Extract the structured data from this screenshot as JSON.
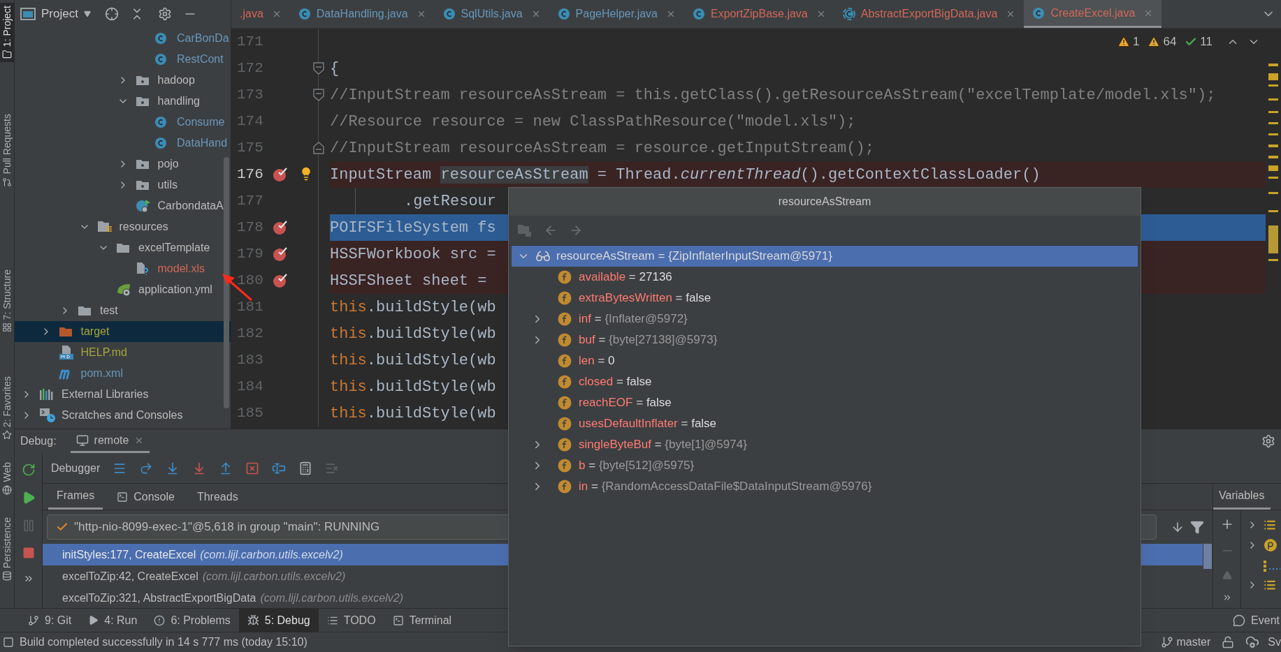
{
  "left_tool_strip": [
    {
      "label": "1: Project",
      "selected": true
    },
    {
      "label": "Pull Requests",
      "selected": false
    },
    {
      "label": "7: Structure",
      "selected": false
    },
    {
      "label": "2: Favorites",
      "selected": false
    },
    {
      "label": "Web",
      "selected": false
    },
    {
      "label": "Persistence",
      "selected": false
    }
  ],
  "project_panel": {
    "title": "Project",
    "tree": [
      {
        "children": [
          {
            "children": [
              {
                "children": [
                  {
                    "children": [
                      {
                        "children": [
                          {
                            "children": [
                              {
                                "label": "CarBonDa",
                                "kind": "class",
                                "color": "#6897bb",
                                "selected": false
                              },
                              {
                                "label": "RestCont",
                                "kind": "class",
                                "color": "#6897bb",
                                "selected": false
                              }
                            ]
                          },
                          {
                            "label": "hadoop",
                            "kind": "package",
                            "color": "#bbbbbb",
                            "expanded": false,
                            "selected": false
                          },
                          {
                            "label": "handling",
                            "kind": "package",
                            "color": "#bbbbbb",
                            "expanded": true,
                            "selected": false,
                            "children": [
                              {
                                "label": "Consume",
                                "kind": "class",
                                "color": "#6897bb",
                                "selected": false
                              },
                              {
                                "label": "DataHand",
                                "kind": "class",
                                "color": "#6897bb",
                                "selected": false
                              }
                            ]
                          },
                          {
                            "label": "pojo",
                            "kind": "package",
                            "color": "#bbbbbb",
                            "expanded": false,
                            "selected": false
                          },
                          {
                            "label": "utils",
                            "kind": "package",
                            "color": "#bbbbbb",
                            "expanded": false,
                            "selected": false
                          },
                          {
                            "label": "CarbondataA",
                            "kind": "boot-class",
                            "color": "#bbbbbb",
                            "selected": false
                          }
                        ]
                      }
                    ]
                  },
                  {
                    "label": "resources",
                    "kind": "resources-folder",
                    "color": "#bbbbbb",
                    "expanded": true,
                    "selected": false,
                    "children": [
                      {
                        "label": "excelTemplate",
                        "kind": "folder",
                        "color": "#bbbbbb",
                        "expanded": true,
                        "selected": false,
                        "children": [
                          {
                            "label": "model.xls",
                            "kind": "unknown-file",
                            "color": "#d1675a",
                            "selected": false
                          }
                        ]
                      },
                      {
                        "label": "application.yml",
                        "kind": "spring-config",
                        "color": "#bbbbbb",
                        "selected": false
                      }
                    ]
                  }
                ]
              },
              {
                "label": "test",
                "kind": "folder",
                "color": "#bbbbbb",
                "expanded": false,
                "selected": false
              }
            ]
          },
          {
            "label": "target",
            "kind": "excluded-folder",
            "color": "#a8a43c",
            "expanded": false,
            "selected": true
          },
          {
            "label": "HELP.md",
            "kind": "markdown",
            "color": "#a8a43c",
            "selected": false
          },
          {
            "label": "pom.xml",
            "kind": "maven",
            "color": "#6897bb",
            "selected": false
          }
        ]
      },
      {
        "label": "External Libraries",
        "kind": "libraries",
        "color": "#bbbbbb",
        "expanded": false,
        "selected": false
      },
      {
        "label": "Scratches and Consoles",
        "kind": "scratches",
        "color": "#bbbbbb",
        "expanded": false,
        "selected": false
      }
    ]
  },
  "editor": {
    "tabs": [
      {
        "label": ".java",
        "kind": "cut",
        "color": "#d1675a",
        "selected": false
      },
      {
        "label": "DataHandling.java",
        "kind": "class",
        "color": "#6897bb",
        "selected": false
      },
      {
        "label": "SqlUtils.java",
        "kind": "class",
        "color": "#6897bb",
        "selected": false
      },
      {
        "label": "PageHelper.java",
        "kind": "class",
        "color": "#6897bb",
        "selected": false
      },
      {
        "label": "ExportZipBase.java",
        "kind": "class",
        "color": "#d1675a",
        "selected": false
      },
      {
        "label": "AbstractExportBigData.java",
        "kind": "abstract",
        "color": "#d1675a",
        "selected": false
      },
      {
        "label": "CreateExcel.java",
        "kind": "class",
        "color": "#d1675a",
        "selected": true
      }
    ],
    "inspections": [
      {
        "kind": "warning",
        "count": "1"
      },
      {
        "kind": "weak-warning",
        "count": "64"
      },
      {
        "kind": "typo",
        "count": "11"
      }
    ],
    "lines": [
      {
        "number": "171",
        "kind": "plain",
        "current": false,
        "breakpoint": false,
        "execution": false,
        "bulb": false
      },
      {
        "number": "172",
        "kind": "fold-start",
        "current": false,
        "breakpoint": false,
        "execution": false,
        "bulb": false,
        "segments": [
          {
            "text": "{",
            "kind": "plain"
          }
        ]
      },
      {
        "number": "173",
        "kind": "fold-start",
        "current": false,
        "breakpoint": false,
        "execution": false,
        "bulb": false,
        "segments": [
          {
            "text": "//InputStream resourceAsStream = this.getClass().getResourceAsStream(\"excelTemplate/model.xls\");",
            "kind": "comment"
          }
        ]
      },
      {
        "number": "174",
        "kind": "plain",
        "current": false,
        "breakpoint": false,
        "execution": false,
        "bulb": false,
        "segments": [
          {
            "text": "//Resource resource = new ClassPathResource(\"model.xls\");",
            "kind": "comment"
          }
        ]
      },
      {
        "number": "175",
        "kind": "fold-end",
        "current": false,
        "breakpoint": false,
        "execution": false,
        "bulb": false,
        "segments": [
          {
            "text": "//InputStream resourceAsStream = resource.getInputStream();",
            "kind": "comment"
          }
        ]
      },
      {
        "number": "176",
        "kind": "plain",
        "current": true,
        "breakpoint": true,
        "execution": false,
        "bulb": true,
        "segments": [
          {
            "text": "InputStream ",
            "kind": "plain"
          },
          {
            "text": "resourceAsStream",
            "kind": "highlight"
          },
          {
            "text": " = Thread.",
            "kind": "plain"
          },
          {
            "text": "currentThread",
            "kind": "italic"
          },
          {
            "text": "().getContextClassLoader()",
            "kind": "plain"
          }
        ]
      },
      {
        "number": "177",
        "kind": "continuation",
        "current": false,
        "breakpoint": false,
        "execution": false,
        "bulb": false,
        "segments": [
          {
            "text": ".getResour",
            "kind": "plain"
          }
        ]
      },
      {
        "number": "178",
        "kind": "plain",
        "current": false,
        "breakpoint": true,
        "execution": true,
        "bulb": false,
        "segments": [
          {
            "text": "POIFSFileSystem fs",
            "kind": "plain"
          }
        ]
      },
      {
        "number": "179",
        "kind": "plain",
        "current": false,
        "breakpoint": true,
        "execution": false,
        "bulb": false,
        "segments": [
          {
            "text": "HSSFWorkbook src =",
            "kind": "plain"
          }
        ]
      },
      {
        "number": "180",
        "kind": "plain",
        "current": false,
        "breakpoint": true,
        "execution": false,
        "bulb": false,
        "segments": [
          {
            "text": "HSSFSheet sheet =",
            "kind": "plain"
          }
        ]
      },
      {
        "number": "181",
        "kind": "plain",
        "current": false,
        "breakpoint": false,
        "execution": false,
        "bulb": false,
        "segments": [
          {
            "text": "this",
            "kind": "keyword"
          },
          {
            "text": ".buildStyle(wb",
            "kind": "plain"
          }
        ]
      },
      {
        "number": "182",
        "kind": "plain",
        "current": false,
        "breakpoint": false,
        "execution": false,
        "bulb": false,
        "segments": [
          {
            "text": "this",
            "kind": "keyword"
          },
          {
            "text": ".buildStyle(wb",
            "kind": "plain"
          }
        ]
      },
      {
        "number": "183",
        "kind": "plain",
        "current": false,
        "breakpoint": false,
        "execution": false,
        "bulb": false,
        "segments": [
          {
            "text": "this",
            "kind": "keyword"
          },
          {
            "text": ".buildStyle(wb",
            "kind": "plain"
          }
        ]
      },
      {
        "number": "184",
        "kind": "plain",
        "current": false,
        "breakpoint": false,
        "execution": false,
        "bulb": false,
        "segments": [
          {
            "text": "this",
            "kind": "keyword"
          },
          {
            "text": ".buildStyle(wb",
            "kind": "plain"
          }
        ]
      },
      {
        "number": "185",
        "kind": "plain",
        "current": false,
        "breakpoint": false,
        "execution": false,
        "bulb": false,
        "segments": [
          {
            "text": "this",
            "kind": "keyword"
          },
          {
            "text": ".buildStyle(wb",
            "kind": "plain"
          }
        ]
      }
    ]
  },
  "evaluate_popup": {
    "title": "resourceAsStream",
    "root": {
      "name": "resourceAsStream",
      "operator": "=",
      "value": "{ZipInflaterInputStream@5971}",
      "expanded": true,
      "selected": true
    },
    "fields": [
      {
        "name": "available",
        "operator": "=",
        "value": "27136",
        "kind": "primitive",
        "expandable": false
      },
      {
        "name": "extraBytesWritten",
        "operator": "=",
        "value": "false",
        "kind": "primitive",
        "expandable": false
      },
      {
        "name": "inf",
        "operator": "=",
        "value": "{Inflater@5972}",
        "kind": "reference",
        "expandable": true
      },
      {
        "name": "buf",
        "operator": "=",
        "value": "{byte[27138]@5973}",
        "kind": "reference",
        "expandable": true
      },
      {
        "name": "len",
        "operator": "=",
        "value": "0",
        "kind": "primitive",
        "expandable": false
      },
      {
        "name": "closed",
        "operator": "=",
        "value": "false",
        "kind": "primitive",
        "expandable": false
      },
      {
        "name": "reachEOF",
        "operator": "=",
        "value": "false",
        "kind": "primitive",
        "expandable": false
      },
      {
        "name": "usesDefaultInflater",
        "operator": "=",
        "value": "false",
        "kind": "primitive",
        "expandable": false
      },
      {
        "name": "singleByteBuf",
        "operator": "=",
        "value": "{byte[1]@5974}",
        "kind": "reference",
        "expandable": true
      },
      {
        "name": "b",
        "operator": "=",
        "value": "{byte[512]@5975}",
        "kind": "reference",
        "expandable": true
      },
      {
        "name": "in",
        "operator": "=",
        "value": "{RandomAccessDataFile$DataInputStream@5976}",
        "kind": "reference",
        "expandable": true
      }
    ]
  },
  "debug": {
    "label": "Debug:",
    "session_tab": {
      "label": "remote",
      "selected": true
    },
    "toolbar_label": "Debugger",
    "tabs": [
      {
        "label": "Frames",
        "selected": true
      },
      {
        "label": "Console",
        "selected": false
      },
      {
        "label": "Threads",
        "selected": false
      }
    ],
    "thread": "\"http-nio-8099-exec-1\"@5,618 in group \"main\": RUNNING",
    "frames": [
      {
        "method": "initStyles:177, CreateExcel",
        "package": "(com.lijl.carbon.utils.excelv2)",
        "selected": true
      },
      {
        "method": "excelToZip:42, CreateExcel",
        "package": "(com.lijl.carbon.utils.excelv2)",
        "selected": false
      },
      {
        "method": "excelToZip:321, AbstractExportBigData",
        "package": "(com.lijl.carbon.utils.excelv2)",
        "selected": false
      }
    ],
    "variables_label": "Variables"
  },
  "tool_windows": [
    {
      "label": "9: Git",
      "kind": "git",
      "selected": false
    },
    {
      "label": "4: Run",
      "kind": "run",
      "selected": false
    },
    {
      "label": "6: Problems",
      "kind": "problems",
      "selected": false
    },
    {
      "label": "5: Debug",
      "kind": "debug",
      "selected": true
    },
    {
      "label": "TODO",
      "kind": "todo",
      "selected": false
    },
    {
      "label": "Terminal",
      "kind": "terminal",
      "selected": false
    }
  ],
  "event_log": "Event",
  "status_bar": {
    "message": "Build completed successfully in 14 s 777 ms (today 15:10)",
    "branch": "master",
    "cut_text": "Sv"
  }
}
